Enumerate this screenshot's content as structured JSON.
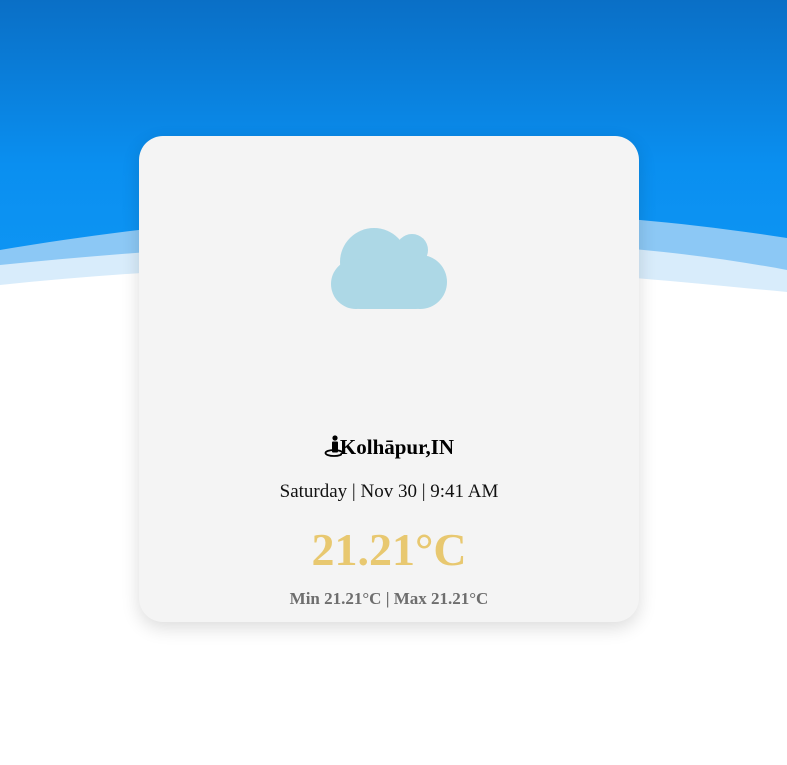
{
  "location": {
    "name": "Kolhāpur,IN",
    "icon": "person-pin-icon"
  },
  "datetime": "Saturday | Nov 30 | 9:41 AM",
  "temperature": "21.21°C",
  "minmax": "Min 21.21°C | Max 21.21°C",
  "weather_icon": "cloud-icon",
  "colors": {
    "sky_top": "#0a6fc6",
    "sky_mid": "#0a8ff0",
    "wave_light": "#8cc8f5",
    "wave_pale": "#d8ecfb",
    "card_bg": "#f4f4f4",
    "cloud": "#add8e6",
    "temperature": "#e8c870",
    "minmax": "#6e6e6e"
  }
}
